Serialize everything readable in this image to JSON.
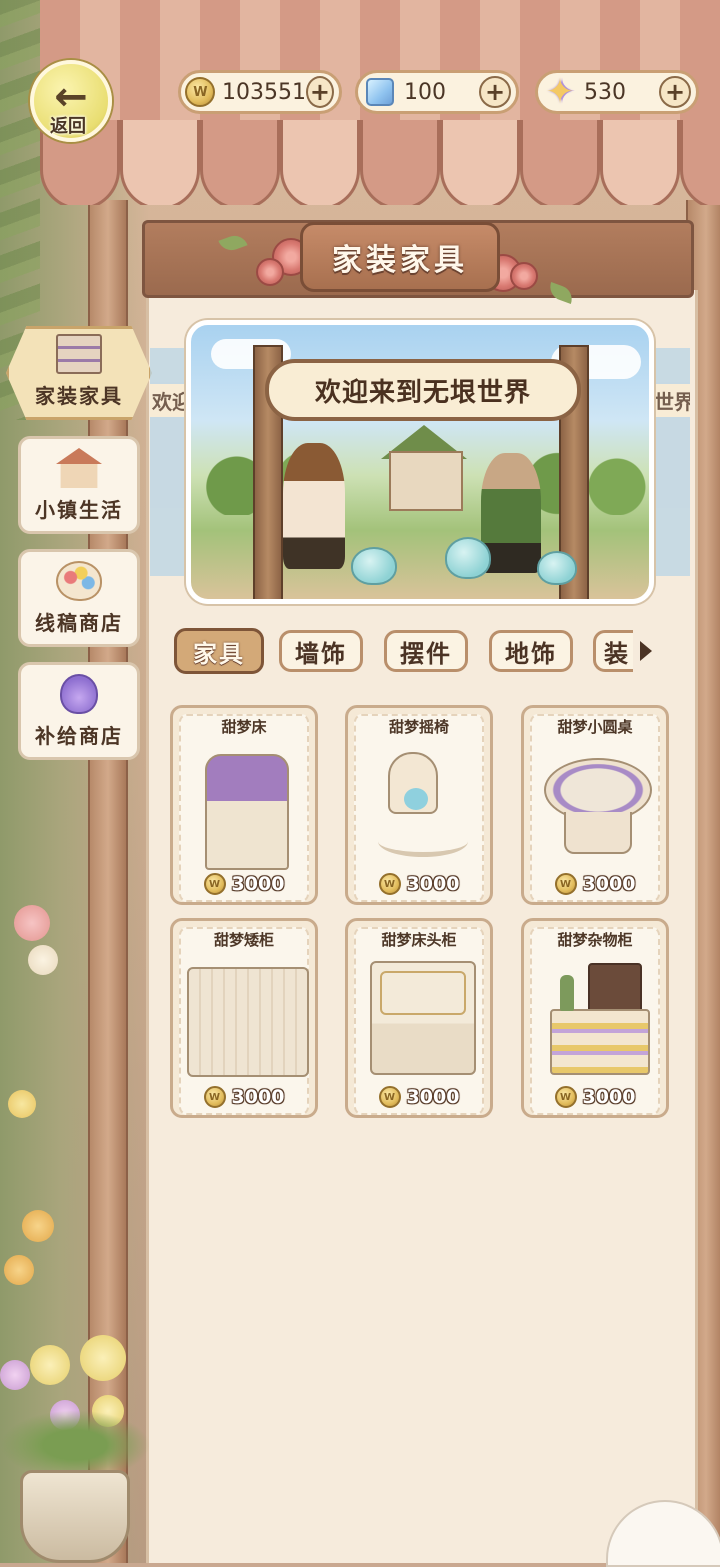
{
  "header": {
    "back_label": "返回",
    "title": "家装家具"
  },
  "currencies": [
    {
      "icon": "coin-icon",
      "value": "103551"
    },
    {
      "icon": "cube-gem-icon",
      "value": "100"
    },
    {
      "icon": "star-icon",
      "value": "530"
    }
  ],
  "sidebar": {
    "items": [
      {
        "label": "家装家具",
        "icon": "furniture-shelf-icon",
        "active": true
      },
      {
        "label": "小镇生活",
        "icon": "house-icon",
        "active": false
      },
      {
        "label": "线稿商店",
        "icon": "palette-icon",
        "active": false
      },
      {
        "label": "补给商店",
        "icon": "potion-icon",
        "active": false
      }
    ]
  },
  "banner": {
    "text": "欢迎来到无垠世界",
    "ghost_left_text": "欢迎",
    "ghost_right_text": "世界"
  },
  "tabs": [
    {
      "label": "家具",
      "active": true
    },
    {
      "label": "墙饰",
      "active": false
    },
    {
      "label": "摆件",
      "active": false
    },
    {
      "label": "地饰",
      "active": false
    },
    {
      "label": "装",
      "active": false
    }
  ],
  "items": [
    {
      "name": "甜梦床",
      "price": "3000"
    },
    {
      "name": "甜梦摇椅",
      "price": "3000"
    },
    {
      "name": "甜梦小圆桌",
      "price": "3000"
    },
    {
      "name": "甜梦矮柜",
      "price": "3000"
    },
    {
      "name": "甜梦床头柜",
      "price": "3000"
    },
    {
      "name": "甜梦杂物柜",
      "price": "3000"
    }
  ],
  "colors": {
    "accent": "#c9a46a",
    "panel": "#f6ebdc",
    "text": "#4b3324"
  }
}
